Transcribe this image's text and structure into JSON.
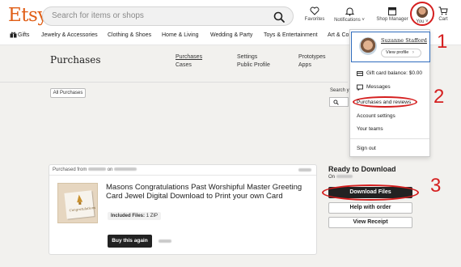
{
  "header": {
    "logo": "Etsy",
    "search_placeholder": "Search for items or shops",
    "favorites": "Favorites",
    "notifications": "Notifications ˅",
    "shop_manager": "Shop Manager",
    "you": "You ˅",
    "cart": "Cart"
  },
  "categories": [
    "Gifts",
    "Jewelry & Accessories",
    "Clothing & Shoes",
    "Home & Living",
    "Wedding & Party",
    "Toys & Entertainment",
    "Art & Co"
  ],
  "page": {
    "title": "Purchases",
    "subnav": [
      "Purchases",
      "Cases",
      "Settings",
      "Public Profile",
      "Prototypes",
      "Apps"
    ],
    "filter_button": "All Purchases",
    "search_label": "Search y"
  },
  "order": {
    "purchased_from": "Purchased from",
    "on": "on",
    "title": "Masons Congratulations Past Worshipful Master Greeting Card Jewel Digital Download to Print your own Card",
    "included_label": "Included Files:",
    "included_value": "1 ZIP",
    "buy_again": "Buy this again",
    "thumb_text": "Congratulations"
  },
  "download_panel": {
    "heading": "Ready to Download",
    "on_date": "On",
    "download_button": "Download Files",
    "help_button": "Help with order",
    "receipt_button": "View Receipt"
  },
  "dropdown": {
    "name": "Suzanne Stafford",
    "view_profile": "View profile",
    "items": [
      "Gift card balance: $0.00",
      "Messages",
      "Purchases and reviews",
      "Account settings",
      "Your teams",
      "Sign out"
    ]
  },
  "callouts": [
    "1",
    "2",
    "3"
  ],
  "colors": {
    "brand": "#e05e16",
    "annotation": "#d51f1f"
  }
}
